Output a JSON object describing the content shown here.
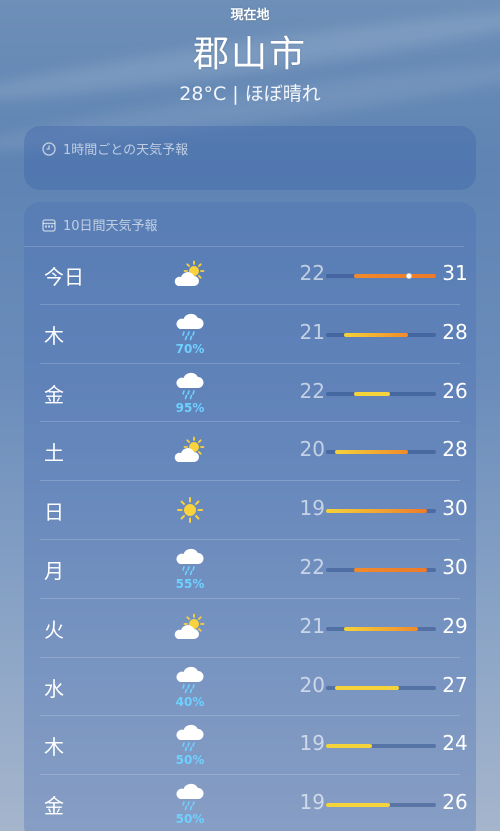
{
  "header": {
    "location_label": "現在地",
    "city": "郡山市",
    "summary": "28°C | ほぼ晴れ"
  },
  "hourly": {
    "title": "1時間ごとの天気予報"
  },
  "daily": {
    "title": "10日間天気予報",
    "range_min": 19,
    "range_max": 31,
    "days": [
      {
        "day": "今日",
        "icon": "partly-sunny-icon",
        "pct": "",
        "lo": "22",
        "hi": "31",
        "current": "28"
      },
      {
        "day": "木",
        "icon": "rain-cloud-icon",
        "pct": "70%",
        "lo": "21",
        "hi": "28"
      },
      {
        "day": "金",
        "icon": "rain-cloud-icon",
        "pct": "95%",
        "lo": "22",
        "hi": "26"
      },
      {
        "day": "土",
        "icon": "partly-sunny-icon",
        "pct": "",
        "lo": "20",
        "hi": "28"
      },
      {
        "day": "日",
        "icon": "sun-icon",
        "pct": "",
        "lo": "19",
        "hi": "30"
      },
      {
        "day": "月",
        "icon": "rain-cloud-icon",
        "pct": "55%",
        "lo": "22",
        "hi": "30"
      },
      {
        "day": "火",
        "icon": "partly-sunny-icon",
        "pct": "",
        "lo": "21",
        "hi": "29"
      },
      {
        "day": "水",
        "icon": "rain-cloud-icon",
        "pct": "40%",
        "lo": "20",
        "hi": "27"
      },
      {
        "day": "木",
        "icon": "rain-cloud-icon",
        "pct": "50%",
        "lo": "19",
        "hi": "24"
      },
      {
        "day": "金",
        "icon": "rain-cloud-icon",
        "pct": "50%",
        "lo": "19",
        "hi": "26"
      }
    ]
  },
  "colors": {
    "precip": "#6fd0ff",
    "bar_cool": "#f5d33a",
    "bar_warm": "#f08a2c",
    "bar_hot": "#ee7a2a"
  }
}
